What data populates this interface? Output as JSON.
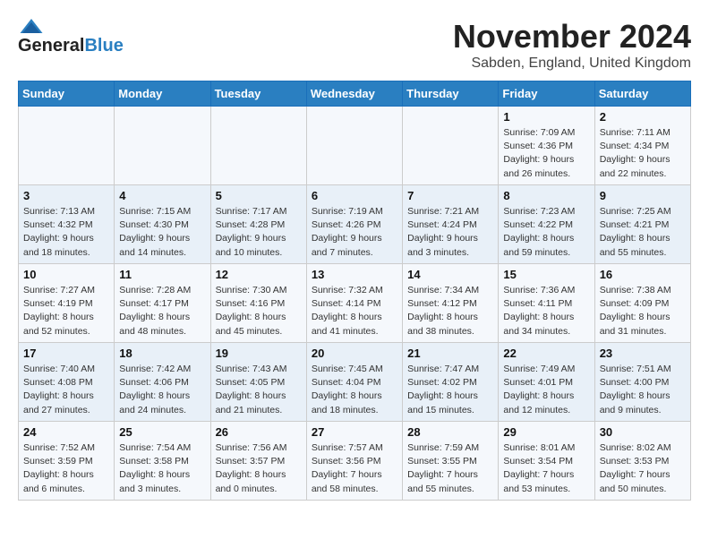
{
  "header": {
    "logo_line1": "General",
    "logo_line2": "Blue",
    "month_title": "November 2024",
    "location": "Sabden, England, United Kingdom"
  },
  "weekdays": [
    "Sunday",
    "Monday",
    "Tuesday",
    "Wednesday",
    "Thursday",
    "Friday",
    "Saturday"
  ],
  "weeks": [
    [
      {
        "day": "",
        "info": ""
      },
      {
        "day": "",
        "info": ""
      },
      {
        "day": "",
        "info": ""
      },
      {
        "day": "",
        "info": ""
      },
      {
        "day": "",
        "info": ""
      },
      {
        "day": "1",
        "info": "Sunrise: 7:09 AM\nSunset: 4:36 PM\nDaylight: 9 hours\nand 26 minutes."
      },
      {
        "day": "2",
        "info": "Sunrise: 7:11 AM\nSunset: 4:34 PM\nDaylight: 9 hours\nand 22 minutes."
      }
    ],
    [
      {
        "day": "3",
        "info": "Sunrise: 7:13 AM\nSunset: 4:32 PM\nDaylight: 9 hours\nand 18 minutes."
      },
      {
        "day": "4",
        "info": "Sunrise: 7:15 AM\nSunset: 4:30 PM\nDaylight: 9 hours\nand 14 minutes."
      },
      {
        "day": "5",
        "info": "Sunrise: 7:17 AM\nSunset: 4:28 PM\nDaylight: 9 hours\nand 10 minutes."
      },
      {
        "day": "6",
        "info": "Sunrise: 7:19 AM\nSunset: 4:26 PM\nDaylight: 9 hours\nand 7 minutes."
      },
      {
        "day": "7",
        "info": "Sunrise: 7:21 AM\nSunset: 4:24 PM\nDaylight: 9 hours\nand 3 minutes."
      },
      {
        "day": "8",
        "info": "Sunrise: 7:23 AM\nSunset: 4:22 PM\nDaylight: 8 hours\nand 59 minutes."
      },
      {
        "day": "9",
        "info": "Sunrise: 7:25 AM\nSunset: 4:21 PM\nDaylight: 8 hours\nand 55 minutes."
      }
    ],
    [
      {
        "day": "10",
        "info": "Sunrise: 7:27 AM\nSunset: 4:19 PM\nDaylight: 8 hours\nand 52 minutes."
      },
      {
        "day": "11",
        "info": "Sunrise: 7:28 AM\nSunset: 4:17 PM\nDaylight: 8 hours\nand 48 minutes."
      },
      {
        "day": "12",
        "info": "Sunrise: 7:30 AM\nSunset: 4:16 PM\nDaylight: 8 hours\nand 45 minutes."
      },
      {
        "day": "13",
        "info": "Sunrise: 7:32 AM\nSunset: 4:14 PM\nDaylight: 8 hours\nand 41 minutes."
      },
      {
        "day": "14",
        "info": "Sunrise: 7:34 AM\nSunset: 4:12 PM\nDaylight: 8 hours\nand 38 minutes."
      },
      {
        "day": "15",
        "info": "Sunrise: 7:36 AM\nSunset: 4:11 PM\nDaylight: 8 hours\nand 34 minutes."
      },
      {
        "day": "16",
        "info": "Sunrise: 7:38 AM\nSunset: 4:09 PM\nDaylight: 8 hours\nand 31 minutes."
      }
    ],
    [
      {
        "day": "17",
        "info": "Sunrise: 7:40 AM\nSunset: 4:08 PM\nDaylight: 8 hours\nand 27 minutes."
      },
      {
        "day": "18",
        "info": "Sunrise: 7:42 AM\nSunset: 4:06 PM\nDaylight: 8 hours\nand 24 minutes."
      },
      {
        "day": "19",
        "info": "Sunrise: 7:43 AM\nSunset: 4:05 PM\nDaylight: 8 hours\nand 21 minutes."
      },
      {
        "day": "20",
        "info": "Sunrise: 7:45 AM\nSunset: 4:04 PM\nDaylight: 8 hours\nand 18 minutes."
      },
      {
        "day": "21",
        "info": "Sunrise: 7:47 AM\nSunset: 4:02 PM\nDaylight: 8 hours\nand 15 minutes."
      },
      {
        "day": "22",
        "info": "Sunrise: 7:49 AM\nSunset: 4:01 PM\nDaylight: 8 hours\nand 12 minutes."
      },
      {
        "day": "23",
        "info": "Sunrise: 7:51 AM\nSunset: 4:00 PM\nDaylight: 8 hours\nand 9 minutes."
      }
    ],
    [
      {
        "day": "24",
        "info": "Sunrise: 7:52 AM\nSunset: 3:59 PM\nDaylight: 8 hours\nand 6 minutes."
      },
      {
        "day": "25",
        "info": "Sunrise: 7:54 AM\nSunset: 3:58 PM\nDaylight: 8 hours\nand 3 minutes."
      },
      {
        "day": "26",
        "info": "Sunrise: 7:56 AM\nSunset: 3:57 PM\nDaylight: 8 hours\nand 0 minutes."
      },
      {
        "day": "27",
        "info": "Sunrise: 7:57 AM\nSunset: 3:56 PM\nDaylight: 7 hours\nand 58 minutes."
      },
      {
        "day": "28",
        "info": "Sunrise: 7:59 AM\nSunset: 3:55 PM\nDaylight: 7 hours\nand 55 minutes."
      },
      {
        "day": "29",
        "info": "Sunrise: 8:01 AM\nSunset: 3:54 PM\nDaylight: 7 hours\nand 53 minutes."
      },
      {
        "day": "30",
        "info": "Sunrise: 8:02 AM\nSunset: 3:53 PM\nDaylight: 7 hours\nand 50 minutes."
      }
    ]
  ]
}
